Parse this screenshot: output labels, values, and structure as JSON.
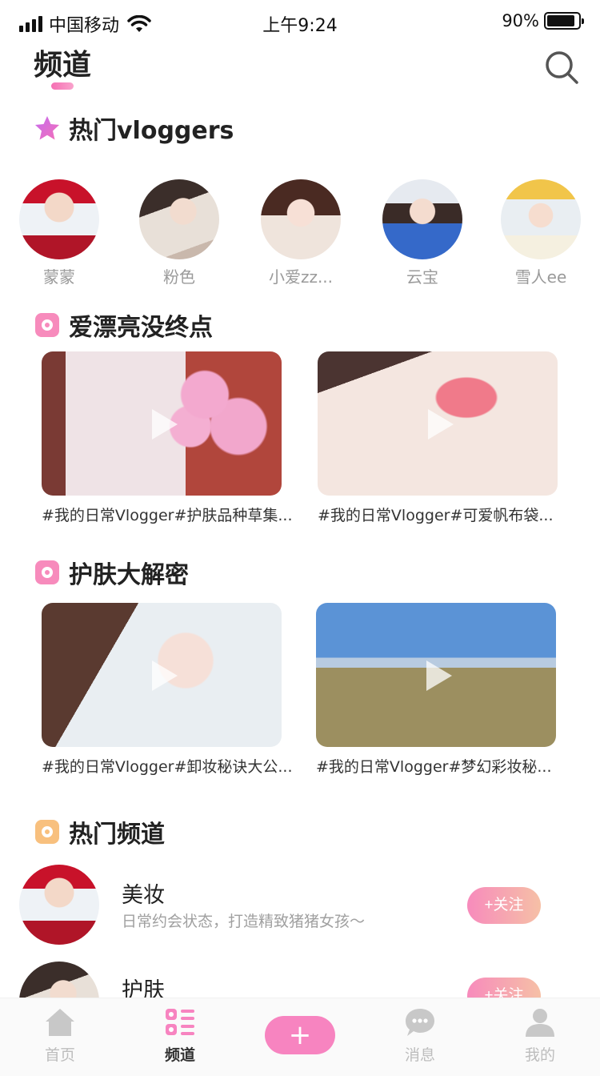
{
  "status_bar": {
    "carrier": "中国移动",
    "time": "上午9:24",
    "battery": "90%",
    "battery_level": 0.9
  },
  "header": {
    "title": "频道",
    "search_icon": "search-icon"
  },
  "hot_vloggers": {
    "title": "热门vloggers",
    "icon": "star-icon",
    "items": [
      {
        "name": "蒙蒙"
      },
      {
        "name": "粉色"
      },
      {
        "name": "小爱zz..."
      },
      {
        "name": "云宝"
      },
      {
        "name": "雪人ee"
      }
    ]
  },
  "section_beauty": {
    "title": "爱漂亮没终点",
    "videos": [
      {
        "caption": "#我的日常Vlogger#护肤品种草集..."
      },
      {
        "caption": "#我的日常Vlogger#可爱帆布袋..."
      }
    ]
  },
  "section_skincare": {
    "title": "护肤大解密",
    "videos": [
      {
        "caption": "#我的日常Vlogger#卸妆秘诀大公..."
      },
      {
        "caption": "#我的日常Vlogger#梦幻彩妆秘..."
      }
    ]
  },
  "hot_channels": {
    "title": "热门频道",
    "items": [
      {
        "name": "美妆",
        "desc": "日常约会状态，打造精致猪猪女孩～",
        "follow_label": "+关注"
      },
      {
        "name": "护肤",
        "desc": "",
        "follow_label": "+关注"
      }
    ]
  },
  "tab_bar": {
    "tabs": [
      {
        "label": "首页",
        "icon": "home-icon"
      },
      {
        "label": "频道",
        "icon": "channel-list-icon"
      },
      {
        "label": "+",
        "icon": "add-icon"
      },
      {
        "label": "消息",
        "icon": "message-icon"
      },
      {
        "label": "我的",
        "icon": "profile-icon"
      }
    ],
    "active": "频道"
  },
  "colors": {
    "accent_pink": "#f784c0",
    "section_orange": "#f8c07e",
    "muted_text": "#9a9a9a"
  }
}
